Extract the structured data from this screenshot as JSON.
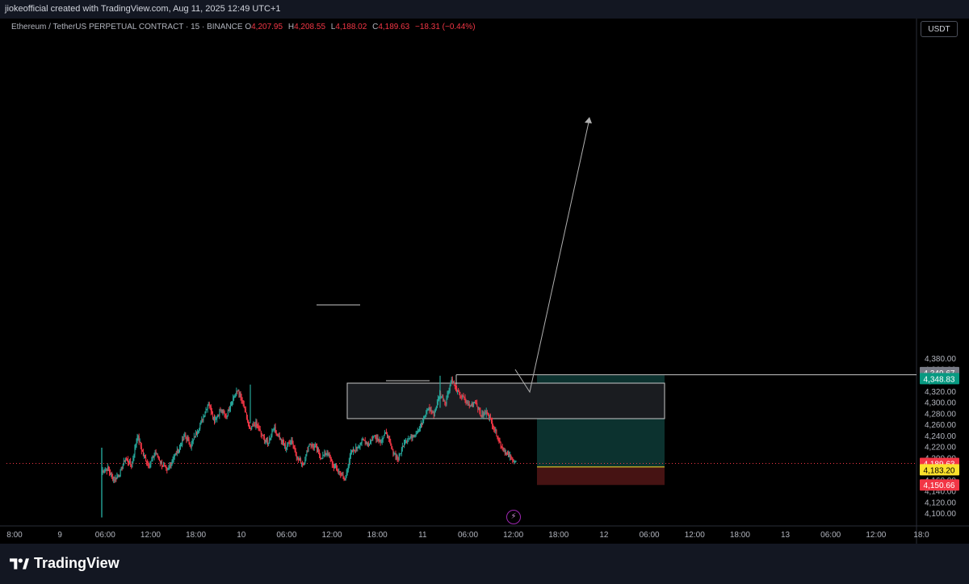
{
  "header": {
    "credit": "jiokeofficial created with TradingView.com, Aug 11, 2025 12:49 UTC+1"
  },
  "legend": {
    "symbol": "Ethereum / TetherUS PERPETUAL CONTRACT · 15 · BINANCE",
    "o_label": "O",
    "o_value": "4,207.95",
    "h_label": "H",
    "h_value": "4,208.55",
    "l_label": "L",
    "l_value": "4,188.02",
    "c_label": "C",
    "c_value": "4,189.63",
    "change": "−18.31 (−0.44%)"
  },
  "unit_button": "USDT",
  "brand": {
    "name": "TradingView",
    "logo_icon": "tradingview-logo-icon"
  },
  "colors": {
    "up": "#26a69a",
    "down": "#f23645",
    "target_zone": "#0d3532",
    "stop_zone": "#4a1414",
    "entry": "#fbe12b",
    "price_line": "#f23645"
  },
  "chart_data": {
    "type": "candlestick",
    "symbol": "ETHUSDT.P",
    "interval": "15",
    "ylim": [
      4090,
      4400
    ],
    "y_ticks": [
      4100,
      4120,
      4140,
      4160,
      4180,
      4200,
      4220,
      4240,
      4260,
      4280,
      4300,
      4320,
      4340,
      4360,
      4380
    ],
    "y_tick_labels": [
      "4,100.00",
      "4,120.00",
      "4,140.00",
      "4,160.00",
      "4,180.00",
      "4,200.00",
      "4,220.00",
      "4,240.00",
      "4,260.00",
      "4,280.00",
      "4,300.00",
      "4,320.00",
      "4,340.00",
      "4,360.00",
      "4,380.00"
    ],
    "x_ticks": [
      "8:00",
      "9",
      "06:00",
      "12:00",
      "18:00",
      "10",
      "06:00",
      "12:00",
      "18:00",
      "11",
      "06:00",
      "12:00",
      "18:00",
      "12",
      "06:00",
      "12:00",
      "18:00",
      "13",
      "06:00",
      "12:00",
      "18:0"
    ],
    "price_path": [
      4175,
      4180,
      4160,
      4170,
      4200,
      4185,
      4240,
      4205,
      4185,
      4210,
      4190,
      4175,
      4200,
      4215,
      4240,
      4222,
      4245,
      4270,
      4300,
      4268,
      4285,
      4275,
      4305,
      4322,
      4290,
      4250,
      4262,
      4240,
      4225,
      4255,
      4235,
      4218,
      4232,
      4198,
      4188,
      4226,
      4218,
      4200,
      4210,
      4185,
      4175,
      4160,
      4208,
      4218,
      4232,
      4225,
      4240,
      4230,
      4245,
      4212,
      4198,
      4228,
      4236,
      4245,
      4262,
      4290,
      4278,
      4315,
      4300,
      4342,
      4318,
      4308,
      4292,
      4302,
      4275,
      4282,
      4258,
      4230,
      4210,
      4200,
      4190
    ],
    "annotations": {
      "current_price": "4,189.63",
      "target_high": "4,349.67",
      "target": "4,348.83",
      "entry": "4,183.20",
      "stop": "4,150.66"
    }
  }
}
